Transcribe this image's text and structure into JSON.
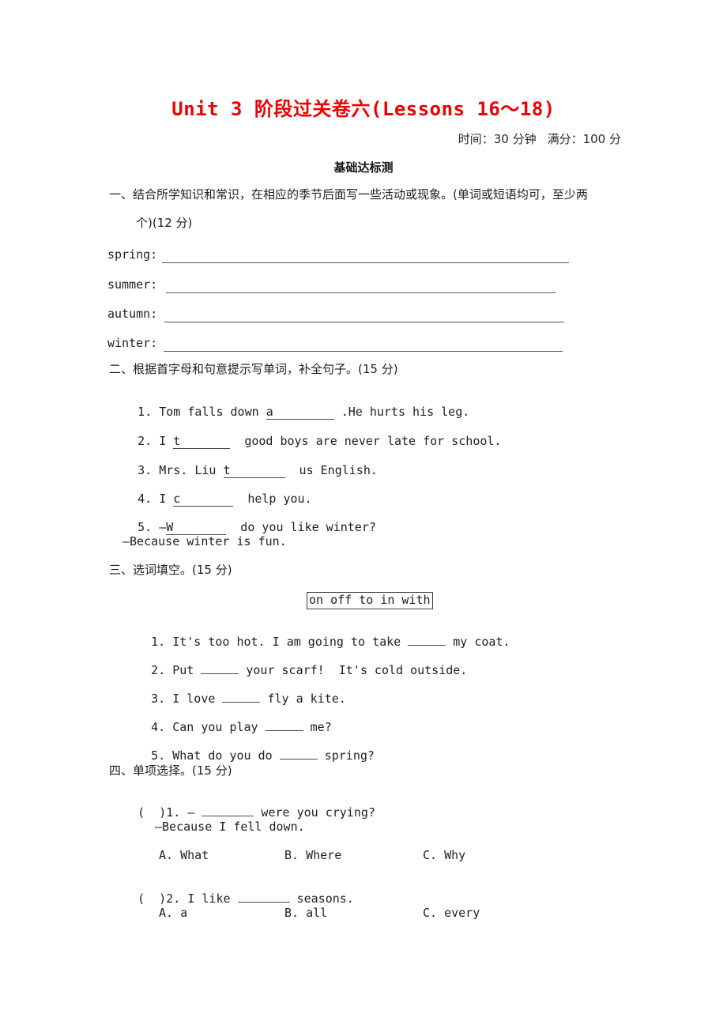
{
  "document": {
    "title": "Unit 3 阶段过关卷六(Lessons 16～18)",
    "meta_time": "时间：30 分钟",
    "meta_score": "满分：100 分",
    "sub_heading": "基础达标测"
  },
  "section1": {
    "heading_line1": "一、结合所学知识和常识，在相应的季节后面写一些活动或现象。(单词或短语均可，至少两",
    "heading_line2": "个)(12 分)",
    "rows": [
      {
        "label": "spring:"
      },
      {
        "label": "summer:"
      },
      {
        "label": "autumn:"
      },
      {
        "label": "winter:"
      }
    ]
  },
  "section2": {
    "heading": "二、根据首字母和句意提示写单词，补全句子。(15 分)",
    "items": [
      {
        "num": "1.",
        "before": " Tom falls down ",
        "hint": "a",
        "after": " .He hurts his leg."
      },
      {
        "num": "2.",
        "before": " I ",
        "hint": "t",
        "after": "  good boys are never late for school."
      },
      {
        "num": "3.",
        "before": " Mrs. Liu ",
        "hint": "t",
        "after": "  us English."
      },
      {
        "num": "4.",
        "before": " I ",
        "hint": "c",
        "after": "  help you."
      },
      {
        "num": "5.",
        "before": " —",
        "hint": "W",
        "after": "  do you like winter?"
      }
    ],
    "item5_answer": "—Because winter is fun."
  },
  "section3": {
    "heading": "三、选词填空。(15 分)",
    "word_bank": "on off to in with",
    "items": [
      {
        "num": "1.",
        "before": " It's too hot. I am going to take ",
        "after": " my coat."
      },
      {
        "num": "2.",
        "before": " Put ",
        "after": " your scarf!  It's cold outside."
      },
      {
        "num": "3.",
        "before": " I love ",
        "after": " fly a kite."
      },
      {
        "num": "4.",
        "before": " Can you play ",
        "after": " me?"
      },
      {
        "num": "5.",
        "before": " What do you do ",
        "after": " spring?"
      }
    ]
  },
  "section4": {
    "heading": "四、单项选择。(15 分)",
    "items": [
      {
        "bracket": "(  )",
        "num": "1.",
        "stem_before": " — ",
        "stem_after": " were you crying?",
        "answer_line": "—Because I fell down.",
        "options": [
          "A. What",
          "B. Where",
          "C. Why"
        ]
      },
      {
        "bracket": "(  )",
        "num": "2.",
        "stem_before": " I like ",
        "stem_after": " seasons.",
        "answer_line": "",
        "options": [
          "A. a",
          "B. all",
          "C. every"
        ]
      }
    ]
  },
  "colors": {
    "title_red": "#f00000",
    "text": "#1e1e1e",
    "rule": "#555555"
  }
}
